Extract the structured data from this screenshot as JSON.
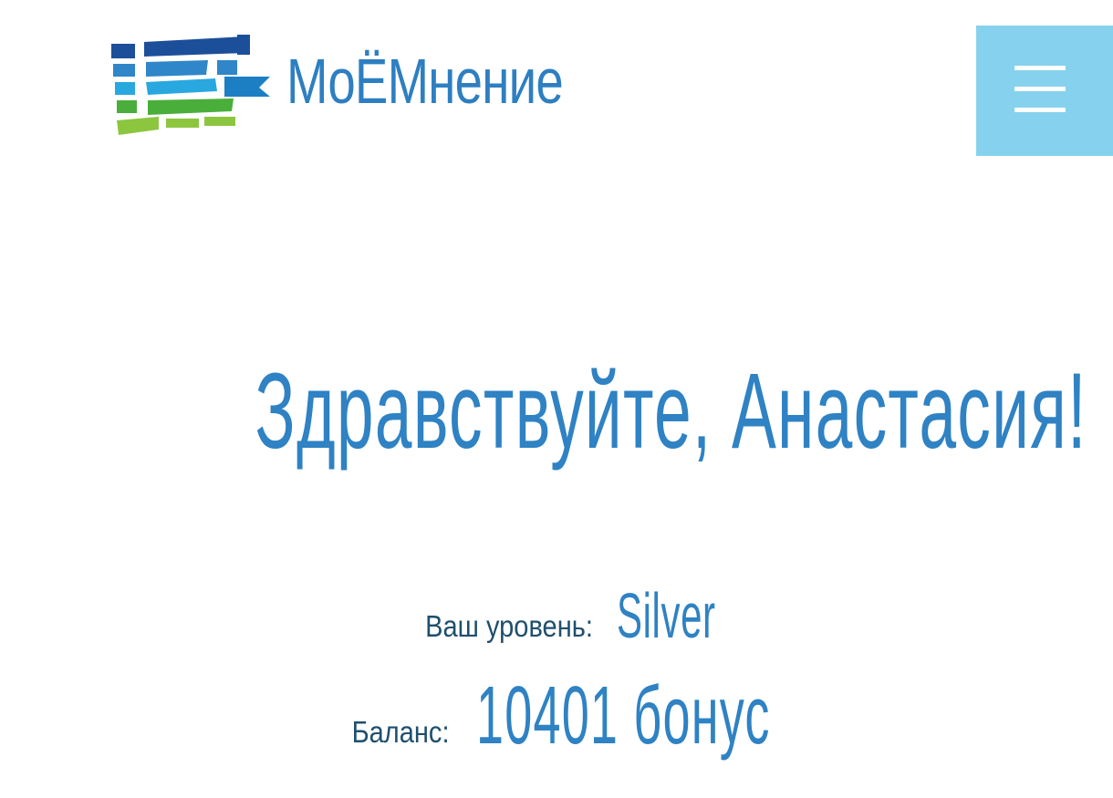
{
  "brand": {
    "name": "МоЁМнение",
    "colors": {
      "primary": "#2e7fc1",
      "menu_background": "#86d2ee",
      "text_dark": "#1f4f6e",
      "logo_blue_dark": "#1c4f9a",
      "logo_blue": "#2f86c8",
      "logo_cyan": "#29a8df",
      "logo_green": "#4aae3b",
      "logo_lime": "#8cc63f"
    }
  },
  "header": {
    "logo_icon": "stacked-stripes-logo-icon",
    "menu_icon": "hamburger-menu-icon"
  },
  "main": {
    "greeting": "Здравствуйте, Анастасия!",
    "level_label": "Ваш уровень:",
    "level_value": "Silver",
    "balance_label": "Баланс:",
    "balance_value": "10401 бонус"
  }
}
